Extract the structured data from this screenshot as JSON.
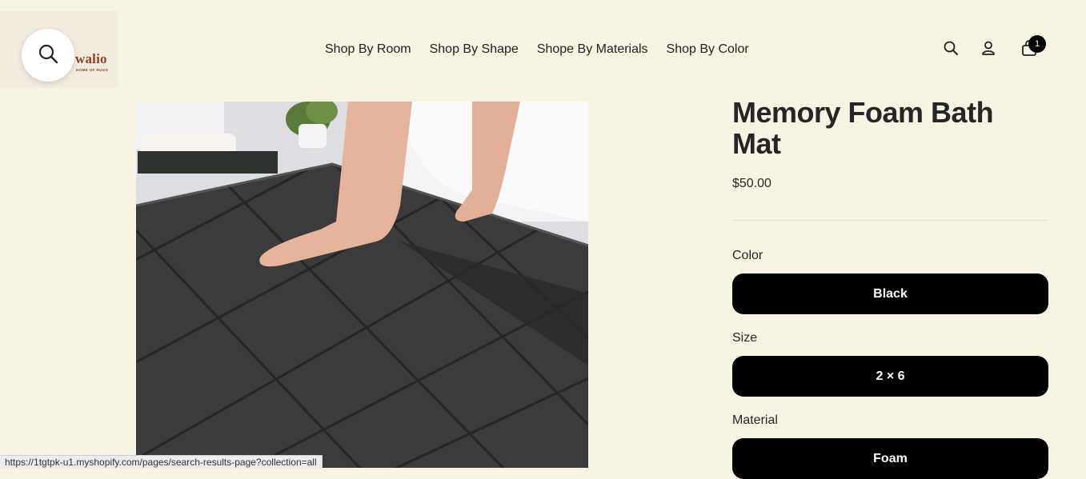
{
  "header": {
    "logo_text": "walio",
    "logo_tagline": "HOME OF RUGS",
    "nav": [
      {
        "label": "Shop By Room"
      },
      {
        "label": "Shop By Shape"
      },
      {
        "label": "Shope By Materials"
      },
      {
        "label": "Shop By Color"
      }
    ],
    "icons": [
      "search-icon",
      "account-icon",
      "cart-icon"
    ],
    "cart_count": "1"
  },
  "product": {
    "title": "Memory Foam Bath Mat",
    "price": "$50.00",
    "image_name": "bath-mat-product-image",
    "options": [
      {
        "label": "Color",
        "value": "Black"
      },
      {
        "label": "Size",
        "value": "2 × 6"
      },
      {
        "label": "Material",
        "value": "Foam"
      }
    ]
  },
  "status_bar": {
    "url": "https://1tgtpk-u1.myshopify.com/pages/search-results-page?collection=all"
  },
  "colors": {
    "background": "#f8f4e4",
    "brand": "#9b3b23",
    "button": "#000000",
    "button_text": "#ffffff"
  }
}
